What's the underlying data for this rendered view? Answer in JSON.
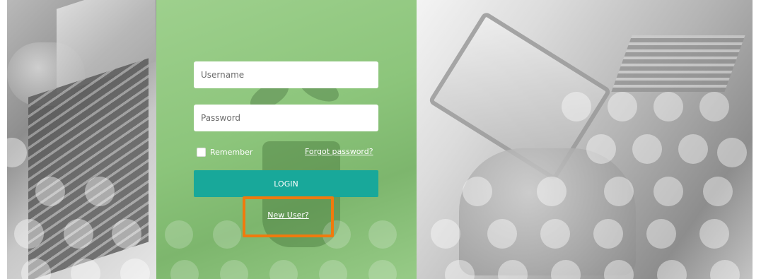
{
  "login_form": {
    "username_placeholder": "Username",
    "password_placeholder": "Password",
    "remember_label": "Remember",
    "forgot_password_link": "Forgot password?",
    "login_button": "LOGIN",
    "new_user_link": "New User?"
  },
  "colors": {
    "center_panel_green": "#8cc57b",
    "login_button": "#18a89a",
    "highlight_outline": "#f07a0d",
    "left_and_right_panels": "grayscale photos"
  },
  "icons": [
    "remember-checkbox"
  ]
}
